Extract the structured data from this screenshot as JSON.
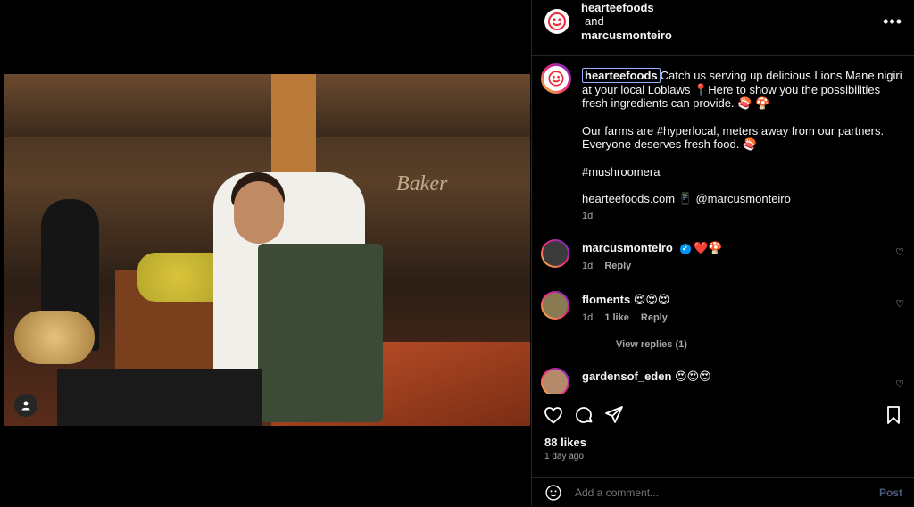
{
  "post": {
    "header": {
      "user1": "hearteefoods",
      "joiner": "and",
      "user2": "marcusmonteiro",
      "more": "•••"
    },
    "caption": {
      "username": "hearteefoods",
      "line1": "Catch us serving up delicious Lions Mane nigiri at your local Loblaws 📍Here to show you the possibilities fresh ingredients can provide. 🍣 🍄",
      "line2": "Our farms are #hyperlocal, meters away from our partners. Everyone deserves fresh food. 🍣",
      "line3": "#mushroomera",
      "line4": "hearteefoods.com 📱 @marcusmonteiro",
      "time": "1d"
    },
    "photo": {
      "sign": "Baker"
    },
    "comments": [
      {
        "user": "marcusmonteiro",
        "verified": "✔",
        "text": "❤️🍄",
        "time": "1d",
        "reply": "Reply"
      },
      {
        "user": "floments",
        "text": "😍😍😍",
        "time": "1d",
        "likes": "1 like",
        "reply": "Reply",
        "view_replies": "View replies (1)"
      },
      {
        "user": "gardensof_eden",
        "text": "😍😍😍"
      }
    ],
    "likes": "88 likes",
    "posted": "1 day ago",
    "add_comment": {
      "placeholder": "Add a comment...",
      "post": "Post"
    }
  },
  "colors": {
    "accent": "#0095f6",
    "brand": "#ee2a3b"
  },
  "icons": [
    "heart-icon",
    "comment-icon",
    "share-icon",
    "bookmark-icon",
    "emoji-icon",
    "more-icon",
    "user-tag-icon"
  ]
}
